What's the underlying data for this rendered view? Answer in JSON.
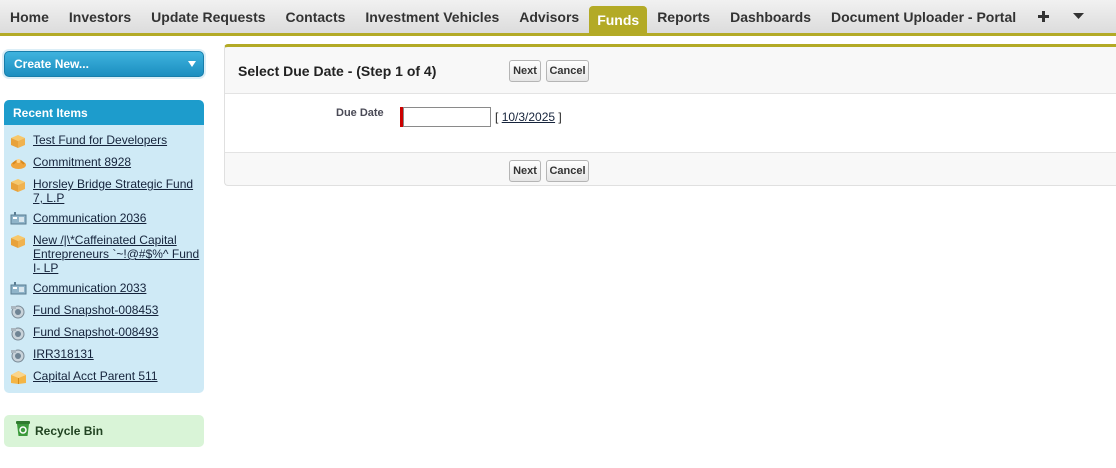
{
  "nav": {
    "tabs": [
      "Home",
      "Investors",
      "Update Requests",
      "Contacts",
      "Investment Vehicles",
      "Advisors",
      "Funds",
      "Reports",
      "Dashboards",
      "Document Uploader - Portal"
    ],
    "active_tab": "Funds",
    "plus_icon": "plus-icon",
    "more_icon": "chevron-down-icon"
  },
  "sidebar": {
    "create_new": "Create New...",
    "recent_title": "Recent Items",
    "recent_items": [
      {
        "label": "Test Fund for Developers",
        "icon": "fund-box-icon"
      },
      {
        "label": "Commitment 8928",
        "icon": "commitment-icon"
      },
      {
        "label": "Horsley Bridge Strategic Fund 7, L.P",
        "icon": "fund-box-icon"
      },
      {
        "label": "Communication 2036",
        "icon": "communication-icon"
      },
      {
        "label": "New /|\\*Caffeinated Capital Entrepreneurs `~!@#$%^ Fund I- LP",
        "icon": "fund-box-icon"
      },
      {
        "label": "Communication 2033",
        "icon": "communication-icon"
      },
      {
        "label": "Fund Snapshot-008453",
        "icon": "snapshot-icon"
      },
      {
        "label": "Fund Snapshot-008493",
        "icon": "snapshot-icon"
      },
      {
        "label": "IRR318131",
        "icon": "snapshot-icon"
      },
      {
        "label": "Capital Acct Parent 511",
        "icon": "capital-account-icon"
      }
    ],
    "recycle_bin": "Recycle Bin"
  },
  "main": {
    "title": "Select Due Date - (Step 1 of 4)",
    "next_label": "Next",
    "cancel_label": "Cancel",
    "due_date_label": "Due Date",
    "due_date_value": "",
    "date_link": "10/3/2025",
    "bracket_open": "[",
    "bracket_close": "]"
  },
  "colors": {
    "accent": "#b3aa26",
    "sidebar_blue": "#1d9ccc",
    "recent_bg": "#cfeaf6",
    "recycle_bg": "#d9f4d7",
    "required": "#cc0000"
  }
}
